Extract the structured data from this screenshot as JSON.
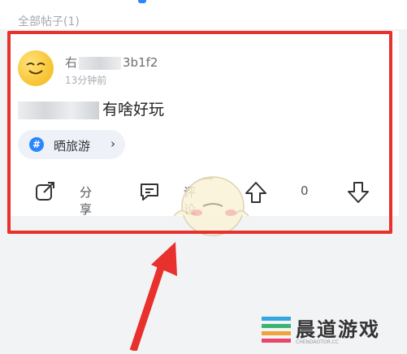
{
  "section": {
    "label": "全部帖子(1)"
  },
  "post": {
    "username_prefix": "右",
    "username_suffix": "3b1f2",
    "timestamp": "13分钟前",
    "text_suffix": "有啥好玩",
    "topic": {
      "hash": "#",
      "label": "晒旅游",
      "arrow": "›"
    },
    "actions": {
      "share_label": "分享",
      "comment_label": "评论",
      "vote_count": "0"
    }
  },
  "watermark": {
    "title": "晨道游戏",
    "sub": "CHENDAOTOR.CC"
  },
  "colors": {
    "accent": "#2a86ff",
    "highlight": "#e8302c",
    "background": "#f2f3f5"
  },
  "icons": [
    "share-icon",
    "comment-icon",
    "upvote-icon",
    "downvote-icon",
    "topic-hash-icon",
    "chevron-right-icon"
  ]
}
